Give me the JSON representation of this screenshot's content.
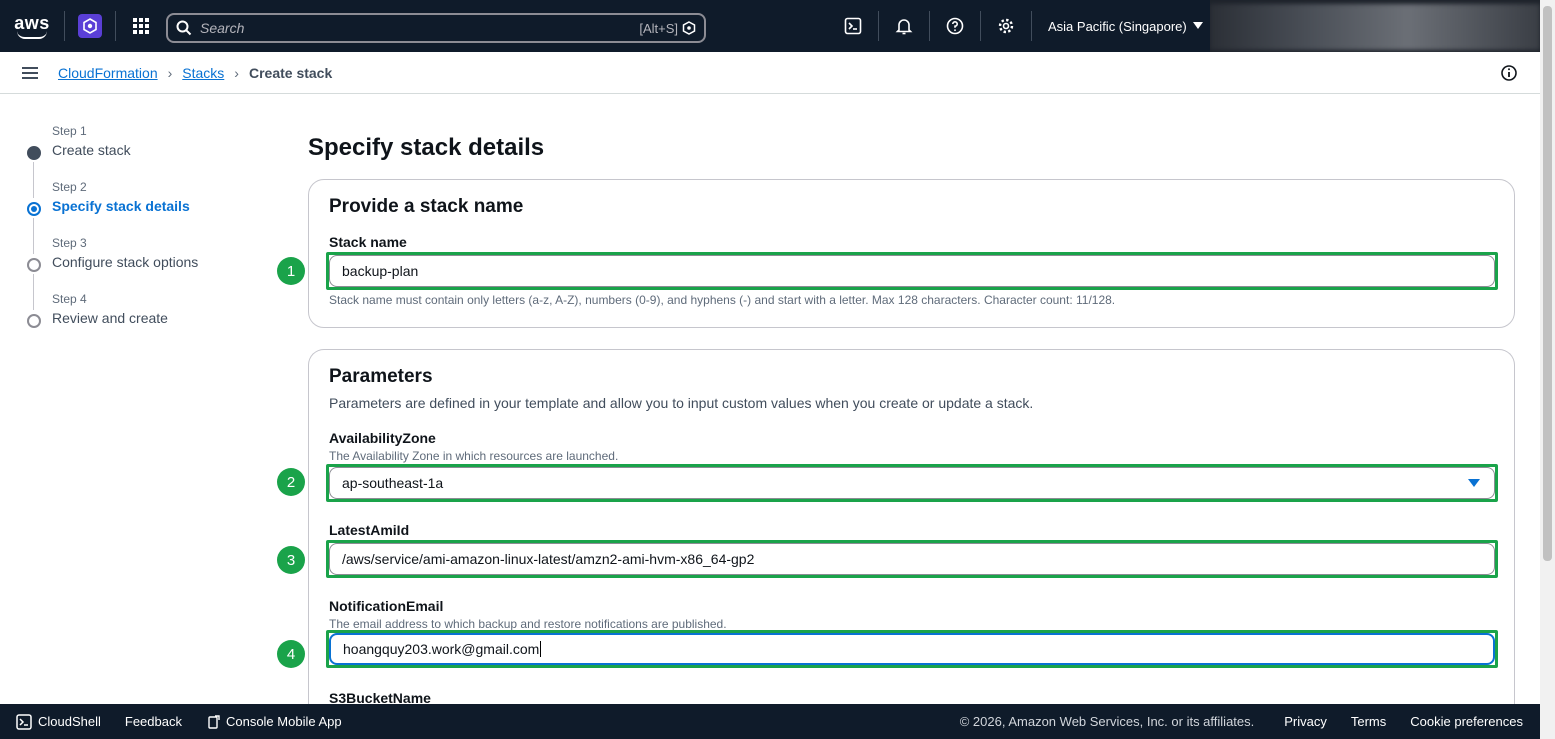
{
  "topnav": {
    "logo_text": "aws",
    "search_placeholder": "Search",
    "search_shortcut": "[Alt+S]",
    "region": "Asia Pacific (Singapore)"
  },
  "breadcrumb": {
    "items": [
      "CloudFormation",
      "Stacks"
    ],
    "current": "Create stack"
  },
  "steps": [
    {
      "num": "Step 1",
      "label": "Create stack",
      "state": "done"
    },
    {
      "num": "Step 2",
      "label": "Specify stack details",
      "state": "active"
    },
    {
      "num": "Step 3",
      "label": "Configure stack options",
      "state": "pending"
    },
    {
      "num": "Step 4",
      "label": "Review and create",
      "state": "pending"
    }
  ],
  "page_title": "Specify stack details",
  "stack_name_section": {
    "heading": "Provide a stack name",
    "label": "Stack name",
    "value": "backup-plan",
    "hint": "Stack name must contain only letters (a-z, A-Z), numbers (0-9), and hyphens (-) and start with a letter. Max 128 characters. Character count: 11/128."
  },
  "parameters_section": {
    "heading": "Parameters",
    "description": "Parameters are defined in your template and allow you to input custom values when you create or update a stack.",
    "availability_zone": {
      "label": "AvailabilityZone",
      "description": "The Availability Zone in which resources are launched.",
      "value": "ap-southeast-1a"
    },
    "latest_ami_id": {
      "label": "LatestAmiId",
      "value": "/aws/service/ami-amazon-linux-latest/amzn2-ami-hvm-x86_64-gp2"
    },
    "notification_email": {
      "label": "NotificationEmail",
      "description": "The email address to which backup and restore notifications are published.",
      "value": "hoangquy203.work@gmail.com"
    },
    "s3_bucket_name": {
      "label": "S3BucketName"
    }
  },
  "badges": [
    "1",
    "2",
    "3",
    "4"
  ],
  "footer": {
    "cloudshell": "CloudShell",
    "feedback": "Feedback",
    "mobile_app": "Console Mobile App",
    "copyright": "© 2026, Amazon Web Services, Inc. or its affiliates.",
    "privacy": "Privacy",
    "terms": "Terms",
    "cookies": "Cookie preferences"
  },
  "colors": {
    "nav_bg": "#0f1b2a",
    "link_blue": "#0972d3",
    "highlight_green": "#1aa34a"
  }
}
